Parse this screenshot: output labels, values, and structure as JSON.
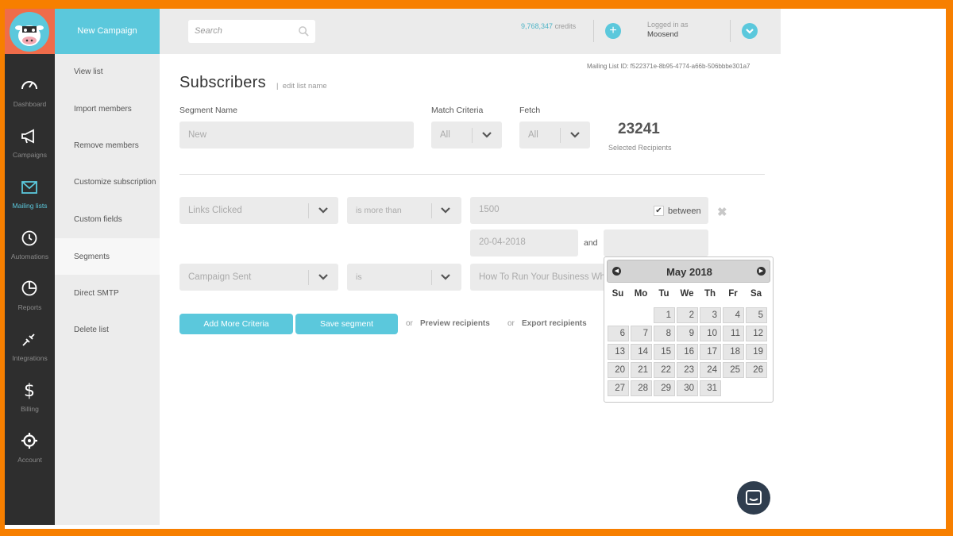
{
  "sidebar": {
    "items": [
      {
        "label": "Dashboard",
        "icon": "dashboard-gauge-icon"
      },
      {
        "label": "Campaigns",
        "icon": "megaphone-icon"
      },
      {
        "label": "Mailing lists",
        "icon": "envelope-icon",
        "active": true
      },
      {
        "label": "Automations",
        "icon": "clock-icon"
      },
      {
        "label": "Reports",
        "icon": "pie-chart-icon"
      },
      {
        "label": "Integrations",
        "icon": "plug-icon"
      },
      {
        "label": "Billing",
        "icon": "dollar-icon"
      },
      {
        "label": "Account",
        "icon": "gear-icon"
      }
    ]
  },
  "submenu": {
    "new_campaign": "New Campaign",
    "items": [
      {
        "label": "View list"
      },
      {
        "label": "Import members"
      },
      {
        "label": "Remove members"
      },
      {
        "label": "Customize subscription"
      },
      {
        "label": "Custom fields"
      },
      {
        "label": "Segments",
        "active": true
      },
      {
        "label": "Direct SMTP"
      },
      {
        "label": "Delete list"
      }
    ]
  },
  "header": {
    "search_placeholder": "Search",
    "credits_value": "9,768,347",
    "credits_label": "credits",
    "logged_in_label": "Logged in as",
    "username": "Moosend"
  },
  "main": {
    "mailing_list_id": "Mailing List ID: f522371e-8b95-4774-a66b-506bbbe301a7",
    "title": "Subscribers",
    "edit_list_name": "edit list name",
    "segment_name_label": "Segment Name",
    "segment_name_placeholder": "New",
    "match_criteria_label": "Match Criteria",
    "match_criteria_value": "All",
    "fetch_label": "Fetch",
    "fetch_value": "All",
    "selected_count": "23241",
    "selected_label": "Selected Recipients",
    "criteria": [
      {
        "field": "Links Clicked",
        "operator": "is more than",
        "value": "1500"
      },
      {
        "field": "Campaign Sent",
        "operator": "is",
        "value": "How To Run Your Business Wh"
      }
    ],
    "between_label": "between",
    "date_from": "20-04-2018",
    "and_label": "and",
    "add_more_label": "Add More Criteria",
    "save_segment_label": "Save segment",
    "or_label": "or",
    "preview_label": "Preview recipients",
    "export_label": "Export recipients"
  },
  "datepicker": {
    "month_title": "May 2018",
    "weekdays": [
      "Su",
      "Mo",
      "Tu",
      "We",
      "Th",
      "Fr",
      "Sa"
    ],
    "days": [
      "1",
      "2",
      "3",
      "4",
      "5",
      "6",
      "7",
      "8",
      "9",
      "10",
      "11",
      "12",
      "13",
      "14",
      "15",
      "16",
      "17",
      "18",
      "19",
      "20",
      "21",
      "22",
      "23",
      "24",
      "25",
      "26",
      "27",
      "28",
      "29",
      "30",
      "31"
    ],
    "first_weekday_index": 2
  }
}
